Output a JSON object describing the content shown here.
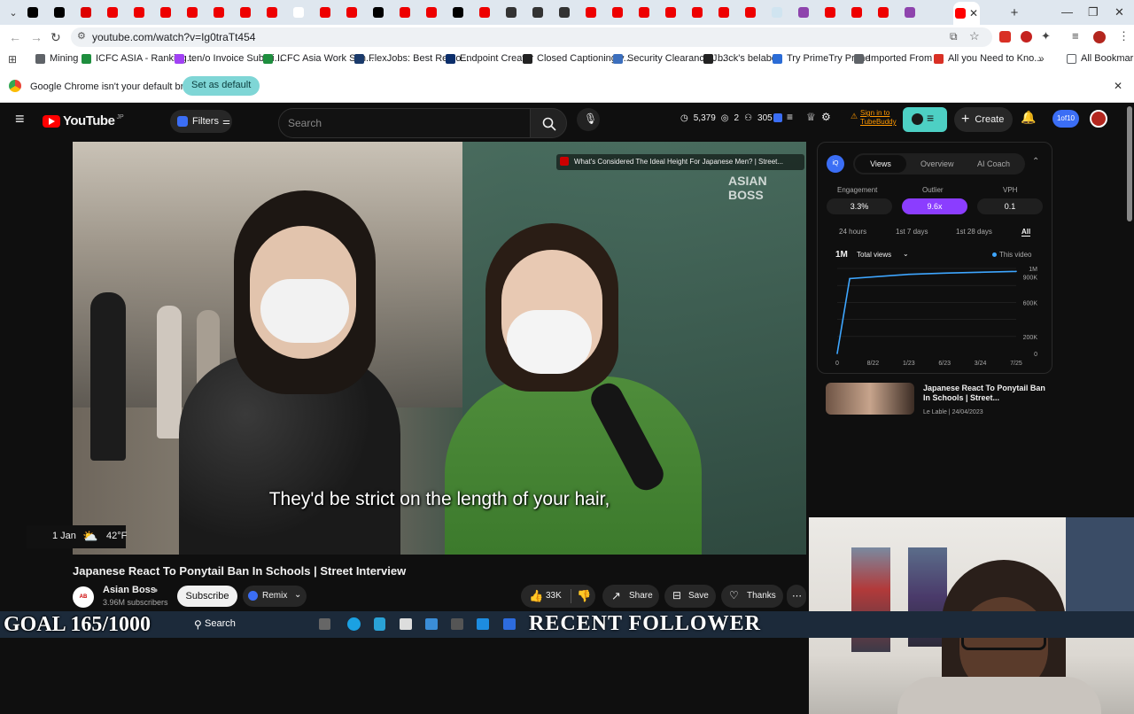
{
  "browser": {
    "url": "youtube.com/watch?v=Ig0traTt454",
    "tab_close_glyph": "✕",
    "new_tab_glyph": "+",
    "window_controls": [
      "—",
      "❐",
      "✕"
    ],
    "bookmarks": [
      {
        "label": "Mining",
        "color": "#5f6368"
      },
      {
        "label": "ICFC ASIA - Ranking...",
        "color": "#1e8e3e"
      },
      {
        "label": "ten/o Invoice Submi...",
        "color": "#a142f4"
      },
      {
        "label": "ICFC Asia Work Sch...",
        "color": "#1e8e3e"
      },
      {
        "label": "FlexJobs: Best Remo...",
        "color": "#1a3a6b"
      },
      {
        "label": "Endpoint Creator",
        "color": "#0b2e6b"
      },
      {
        "label": "Closed Captioning v...",
        "color": "#222"
      },
      {
        "label": "Security Clearance J...",
        "color": "#3c6fbd"
      },
      {
        "label": "b3ck's belabox",
        "color": "#222"
      },
      {
        "label": "Try PrimeTry Prime",
        "color": "#2b6cd6"
      },
      {
        "label": "Imported From IE",
        "color": "#5f6368"
      },
      {
        "label": "All you Need to Kno...",
        "color": "#d93025"
      }
    ],
    "all_bookmarks": "All Bookmarks",
    "infobar_text": "Google Chrome isn't your default browser",
    "infobar_button": "Set as default"
  },
  "youtube": {
    "logo_text": "YouTube",
    "logo_region": "JP",
    "filters_label": "Filters",
    "search_placeholder": "Search",
    "stats": {
      "views": "5,379",
      "score": "2",
      "subs": "305"
    },
    "sign_in": "Sign in to TubeBuddy",
    "create_label": "Create",
    "iq_count": "1of10",
    "video": {
      "end_card_title": "What's Considered The Ideal Height For Japanese Men? | Street...",
      "subtitle": "They'd be strict on the length of your hair,",
      "weather_date": "1 Jan",
      "weather_temp": "42°F",
      "title": "Japanese React To Ponytail Ban In Schools | Street Interview",
      "channel": "Asian Boss",
      "subscribers": "3.96M subscribers",
      "subscribe": "Subscribe",
      "remix": "Remix",
      "likes": "33K",
      "share": "Share",
      "save": "Save",
      "thanks": "Thanks"
    },
    "vidiq": {
      "tabs": [
        "Views",
        "Overview",
        "AI Coach"
      ],
      "metrics": [
        {
          "label": "Engagement",
          "value": "3.3%"
        },
        {
          "label": "Outlier",
          "value": "9.6x"
        },
        {
          "label": "VPH",
          "value": "0.1"
        }
      ],
      "ranges": [
        "24 hours",
        "1st 7 days",
        "1st 28 days",
        "All"
      ],
      "big_label": "1M",
      "dropdown": "Total views",
      "legend": "This video",
      "related_title": "Japanese React To Ponytail Ban In Schools | Street...",
      "related_meta": "Le Lable | 24/04/2023"
    }
  },
  "overlay": {
    "goal": "GOAL 165/1000",
    "recent": "RECENT FOLLOWER"
  },
  "taskbar": {
    "search": "Search"
  },
  "chart_data": {
    "type": "line",
    "title": "",
    "xlabel": "",
    "ylabel": "",
    "x": [
      "0",
      "8/22",
      "1/23",
      "6/23",
      "3/24",
      "7/25"
    ],
    "y_ticks": [
      "0",
      "200K",
      "600K",
      "900K",
      "1M"
    ],
    "ylim": [
      0,
      1000000
    ],
    "series": [
      {
        "name": "This video",
        "values": [
          0,
          880000,
          930000,
          945000,
          955000,
          965000
        ]
      }
    ]
  }
}
